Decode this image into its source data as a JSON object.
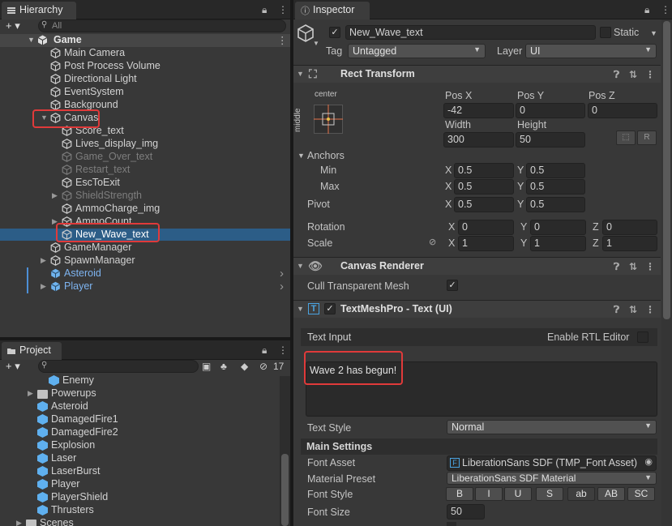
{
  "hierarchy": {
    "tab": "Hierarchy",
    "search_placeholder": "All",
    "add": "+ ▾",
    "scene": "Game",
    "items": [
      {
        "label": "Main Camera"
      },
      {
        "label": "Post Process Volume"
      },
      {
        "label": "Directional Light"
      },
      {
        "label": "EventSystem"
      },
      {
        "label": "Background"
      },
      {
        "label": "Canvas"
      },
      {
        "label": "Score_text"
      },
      {
        "label": "Lives_display_img"
      },
      {
        "label": "Game_Over_text"
      },
      {
        "label": "Restart_text"
      },
      {
        "label": "EscToExit"
      },
      {
        "label": "ShieldStrength"
      },
      {
        "label": "AmmoCharge_img"
      },
      {
        "label": "AmmoCount"
      },
      {
        "label": "New_Wave_text"
      },
      {
        "label": "GameManager"
      },
      {
        "label": "SpawnManager"
      },
      {
        "label": "Asteroid"
      },
      {
        "label": "Player"
      }
    ]
  },
  "project": {
    "tab": "Project",
    "add": "+ ▾",
    "count": "17",
    "items": [
      {
        "label": "Enemy"
      },
      {
        "label": "Powerups"
      },
      {
        "label": "Asteroid"
      },
      {
        "label": "DamagedFire1"
      },
      {
        "label": "DamagedFire2"
      },
      {
        "label": "Explosion"
      },
      {
        "label": "Laser"
      },
      {
        "label": "LaserBurst"
      },
      {
        "label": "Player"
      },
      {
        "label": "PlayerShield"
      },
      {
        "label": "Thrusters"
      },
      {
        "label": "Scenes"
      }
    ]
  },
  "inspector": {
    "tab": "Inspector",
    "object_name": "New_Wave_text",
    "static": "Static",
    "tag_label": "Tag",
    "tag_value": "Untagged",
    "layer_label": "Layer",
    "layer_value": "UI",
    "rect": {
      "title": "Rect Transform",
      "anchor_h": "center",
      "anchor_v": "middle",
      "posx_label": "Pos X",
      "posy_label": "Pos Y",
      "posz_label": "Pos Z",
      "posx": "-42",
      "posy": "0",
      "posz": "0",
      "width_label": "Width",
      "height_label": "Height",
      "width": "300",
      "height": "50",
      "r_btn": "R",
      "anchors": "Anchors",
      "min": "Min",
      "max": "Max",
      "x": "X",
      "y": "Y",
      "z": "Z",
      "min_x": "0.5",
      "min_y": "0.5",
      "max_x": "0.5",
      "max_y": "0.5",
      "pivot": "Pivot",
      "pivot_x": "0.5",
      "pivot_y": "0.5",
      "rotation": "Rotation",
      "rot_x": "0",
      "rot_y": "0",
      "rot_z": "0",
      "scale": "Scale",
      "scale_x": "1",
      "scale_y": "1",
      "scale_z": "1"
    },
    "canvas_renderer": {
      "title": "Canvas Renderer",
      "cull": "Cull Transparent Mesh"
    },
    "tmp": {
      "title": "TextMeshPro - Text (UI)",
      "text_input": "Text Input",
      "rtl": "Enable RTL Editor",
      "text": "Wave 2 has begun!",
      "text_style_label": "Text Style",
      "text_style": "Normal",
      "main_settings": "Main Settings",
      "font_asset_label": "Font Asset",
      "font_asset": "LiberationSans SDF (TMP_Font Asset)",
      "material_label": "Material Preset",
      "material": "LiberationSans SDF Material",
      "font_style_label": "Font Style",
      "font_styles": [
        "B",
        "I",
        "U",
        "S",
        "ab",
        "AB",
        "SC"
      ],
      "font_size_label": "Font Size",
      "font_size": "50"
    }
  },
  "colors": {
    "selection": "#2c5d87",
    "highlight_box": "#e03a3a",
    "prefab_blue": "#7eb4f0"
  }
}
